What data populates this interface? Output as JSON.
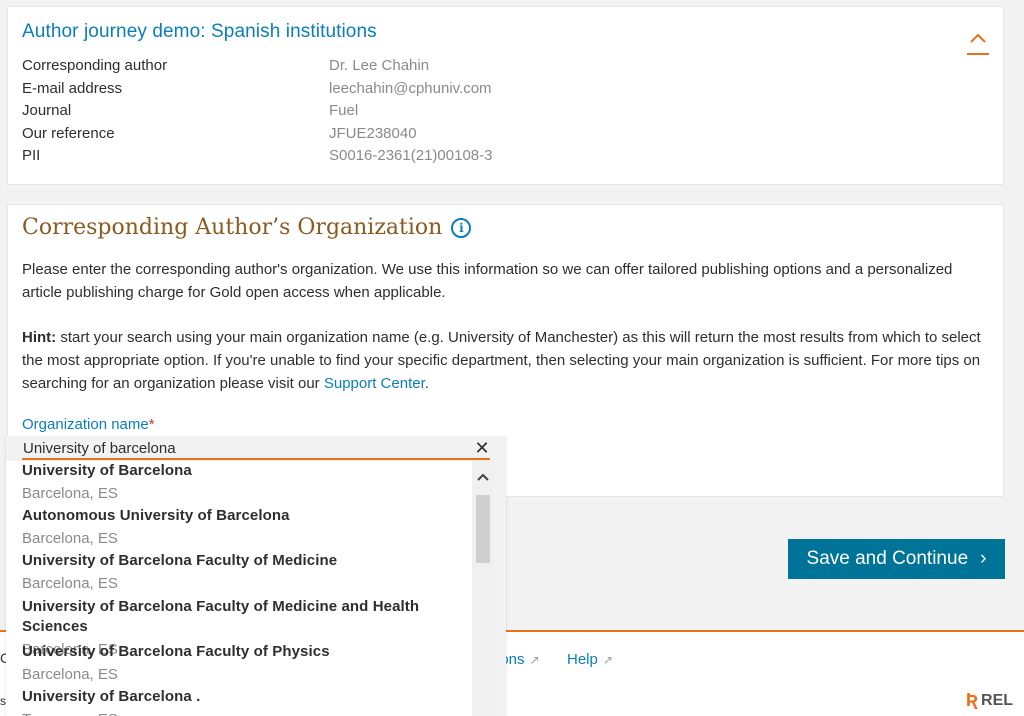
{
  "summary": {
    "title": "Author journey demo: Spanish institutions",
    "rows": [
      {
        "label": "Corresponding author",
        "value": "Dr. Lee Chahin"
      },
      {
        "label": "E-mail address",
        "value": "leechahin@cphuniv.com"
      },
      {
        "label": "Journal",
        "value": "Fuel"
      },
      {
        "label": "Our reference",
        "value": "JFUE238040"
      },
      {
        "label": "PII",
        "value": "S0016-2361(21)00108-3"
      }
    ],
    "collapse_icon": "chevron-up-icon"
  },
  "org": {
    "title": "Corresponding Author’s Organization",
    "info_icon": "info-icon",
    "para1": "Please enter the corresponding author's organization. We use this information so we can offer tailored publishing options and a personalized article publishing charge for Gold open access when applicable.",
    "hint_label": "Hint:",
    "hint_text": " start your search using your main organization name (e.g. University of Manchester) as this will return the most results from which to select the most appropriate option. If you're unable to find your specific department, then selecting your main organization is sufficient. For more tips on searching for an organization please visit our ",
    "support_link": "Support Center",
    "hint_end": ".",
    "field_label": "Organization name",
    "required_mark": "*"
  },
  "search": {
    "value": "University of barcelona",
    "clear_icon": "✕",
    "options": [
      {
        "name": "University of Barcelona",
        "location": "Barcelona, ES"
      },
      {
        "name": "Autonomous University of Barcelona",
        "location": "Barcelona, ES"
      },
      {
        "name": "University of Barcelona Faculty of Medicine",
        "location": "Barcelona, ES"
      },
      {
        "name": "University of Barcelona Faculty of Medicine and Health Sciences",
        "location": "Barcelona, ES"
      },
      {
        "name": "University of Barcelona Faculty of Physics",
        "location": "Barcelona, ES"
      },
      {
        "name": "University of Barcelona .",
        "location": "Tarragona, ES"
      }
    ]
  },
  "actions": {
    "save_label": "Save and Continue",
    "save_icon": "›"
  },
  "footer": {
    "stub_left": "C",
    "stub_left2": "s",
    "link_options": "ions",
    "link_help": "Help",
    "ext_icon": "↗",
    "logo_text": "REL",
    "logo_mark": "Ʀ"
  },
  "colors": {
    "link_blue": "#0c7dbb",
    "title_brown": "#8b5a1f",
    "accent_orange": "#e9711c",
    "button_teal": "#007398"
  }
}
